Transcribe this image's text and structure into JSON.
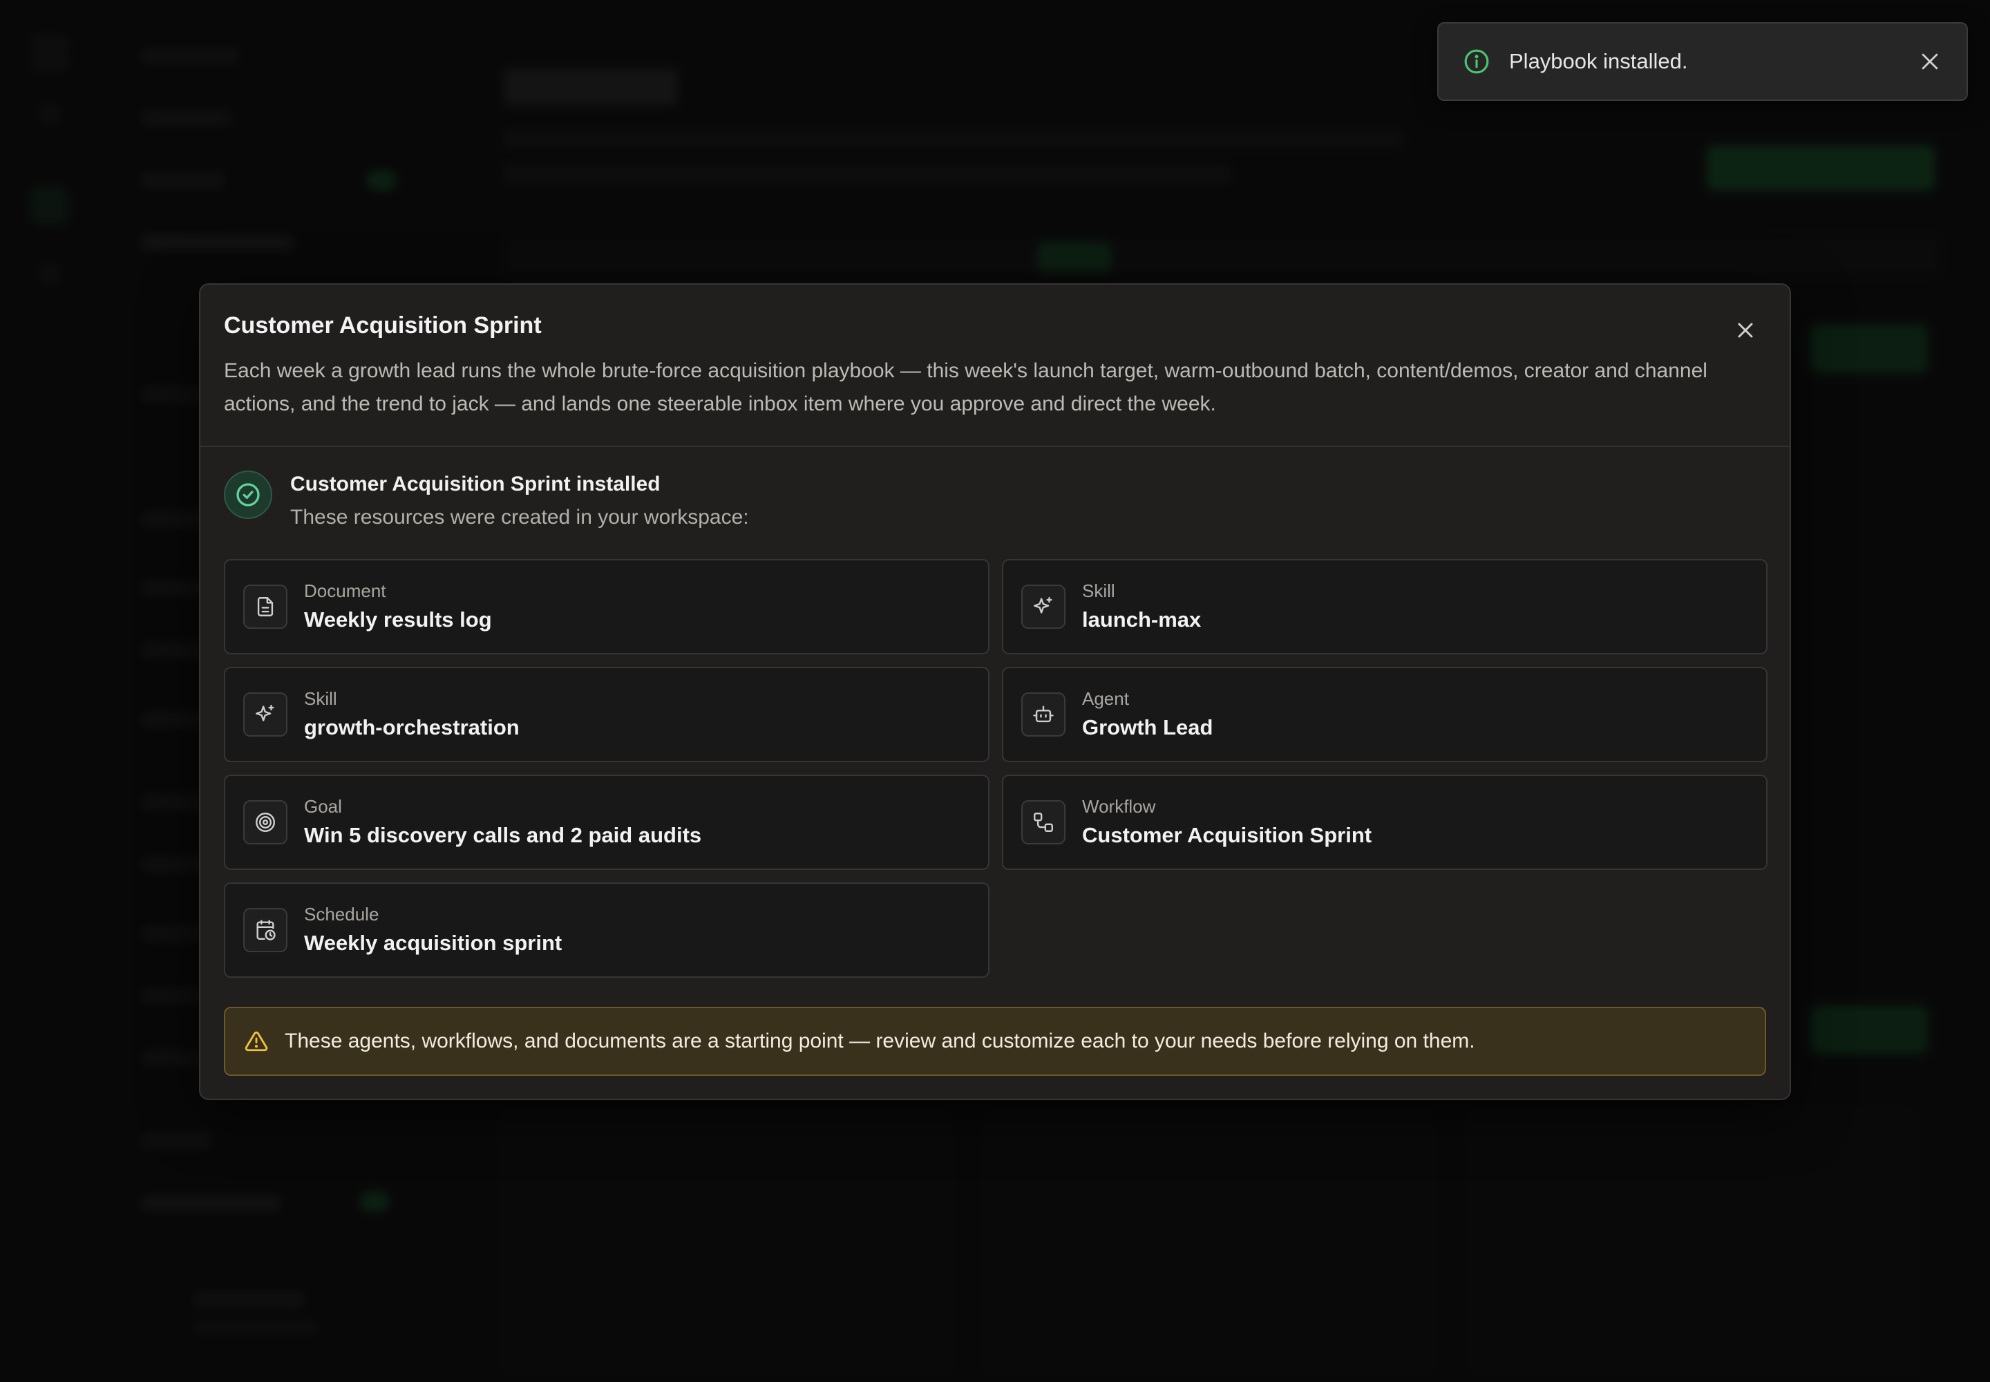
{
  "toast": {
    "message": "Playbook installed.",
    "icon": "info-icon",
    "accent": "#4cc36f"
  },
  "modal": {
    "title": "Customer Acquisition Sprint",
    "description": "Each week a growth lead runs the whole brute-force acquisition playbook — this week's launch target, warm-outbound batch, content/demos, creator and channel actions, and the trend to jack — and lands one steerable inbox item where you approve and direct the week.",
    "installed_title": "Customer Acquisition Sprint installed",
    "installed_subtitle": "These resources were created in your workspace:",
    "resources": [
      {
        "type": "Document",
        "name": "Weekly results log",
        "icon": "document-icon"
      },
      {
        "type": "Skill",
        "name": "launch-max",
        "icon": "sparkle-icon"
      },
      {
        "type": "Skill",
        "name": "growth-orchestration",
        "icon": "sparkle-icon"
      },
      {
        "type": "Agent",
        "name": "Growth Lead",
        "icon": "robot-icon"
      },
      {
        "type": "Goal",
        "name": "Win 5 discovery calls and 2 paid audits",
        "icon": "target-icon"
      },
      {
        "type": "Workflow",
        "name": "Customer Acquisition Sprint",
        "icon": "workflow-icon"
      },
      {
        "type": "Schedule",
        "name": "Weekly acquisition sprint",
        "icon": "calendar-clock-icon"
      }
    ],
    "warning": "These agents, workflows, and documents are a starting point — review and customize each to your needs before relying on them."
  },
  "colors": {
    "success": "#5fd39a",
    "warning_accent": "#f0c23c",
    "modal_bg": "#201f1e"
  }
}
